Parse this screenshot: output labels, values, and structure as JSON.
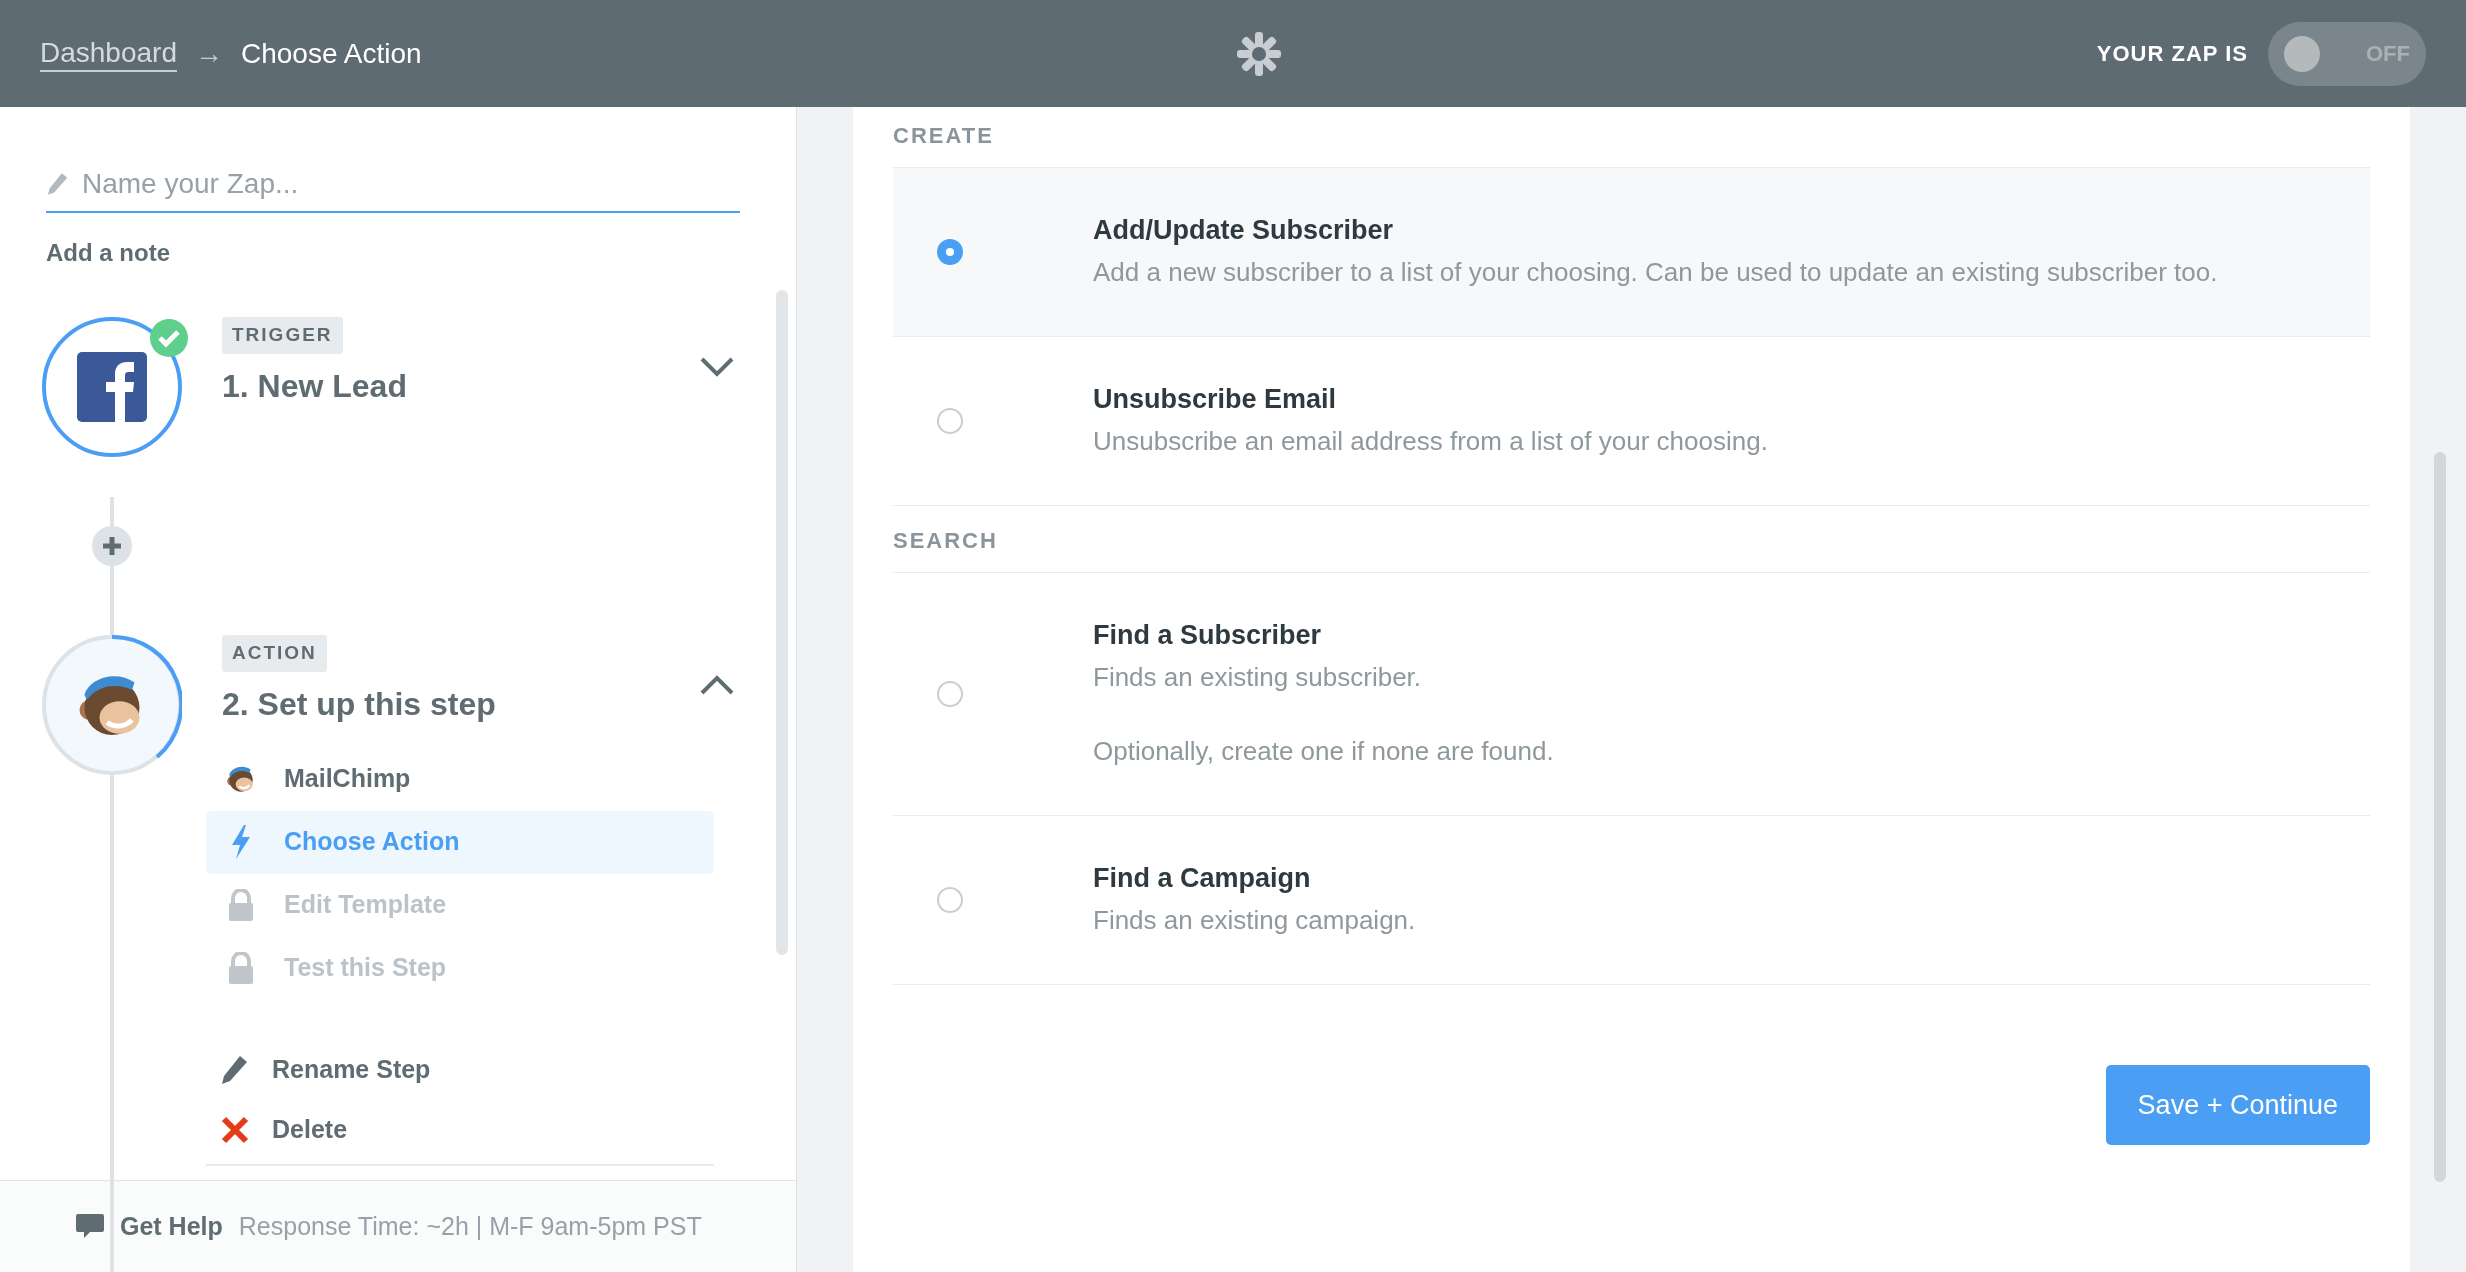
{
  "header": {
    "breadcrumb": [
      {
        "label": "Dashboard",
        "kind": "link"
      },
      {
        "label": "Choose Action",
        "kind": "current"
      }
    ],
    "separator": "→",
    "zap_status_label": "YOUR ZAP IS",
    "toggle": {
      "on": false,
      "label": "OFF"
    }
  },
  "sidebar": {
    "name_field": {
      "placeholder": "Name your Zap..."
    },
    "add_note": "Add a note",
    "steps": [
      {
        "badge": "TRIGGER",
        "title": "1. New Lead",
        "kind": "facebook",
        "complete": true,
        "expanded": false
      },
      {
        "badge": "ACTION",
        "title": "2. Set up this step",
        "kind": "mailchimp",
        "complete": false,
        "expanded": true,
        "items": [
          {
            "label": "MailChimp",
            "kind": "app",
            "selected": false,
            "disabled": false
          },
          {
            "label": "Choose Action",
            "kind": "bolt",
            "selected": true,
            "disabled": false
          },
          {
            "label": "Edit Template",
            "kind": "lock",
            "selected": false,
            "disabled": true
          },
          {
            "label": "Test this Step",
            "kind": "lock",
            "selected": false,
            "disabled": true
          }
        ],
        "actions": [
          {
            "label": "Rename Step",
            "kind": "rename"
          },
          {
            "label": "Delete",
            "kind": "delete"
          }
        ]
      }
    ],
    "footer": {
      "label": "Get Help",
      "info": "Response Time: ~2h | M-F 9am-5pm PST"
    }
  },
  "main": {
    "sections": [
      {
        "title": "CREATE",
        "options": [
          {
            "title": "Add/Update Subscriber",
            "description": "Add a new subscriber to a list of your choosing. Can be used to update an existing subscriber too.",
            "selected": true
          },
          {
            "title": "Unsubscribe Email",
            "description": "Unsubscribe an email address from a list of your choosing.",
            "selected": false
          }
        ]
      },
      {
        "title": "SEARCH",
        "options": [
          {
            "title": "Find a Subscriber",
            "description": "Finds an existing subscriber.",
            "note": "Optionally, create one if none are found.",
            "selected": false
          },
          {
            "title": "Find a Campaign",
            "description": "Finds an existing campaign.",
            "selected": false
          }
        ]
      }
    ],
    "button": "Save + Continue"
  }
}
